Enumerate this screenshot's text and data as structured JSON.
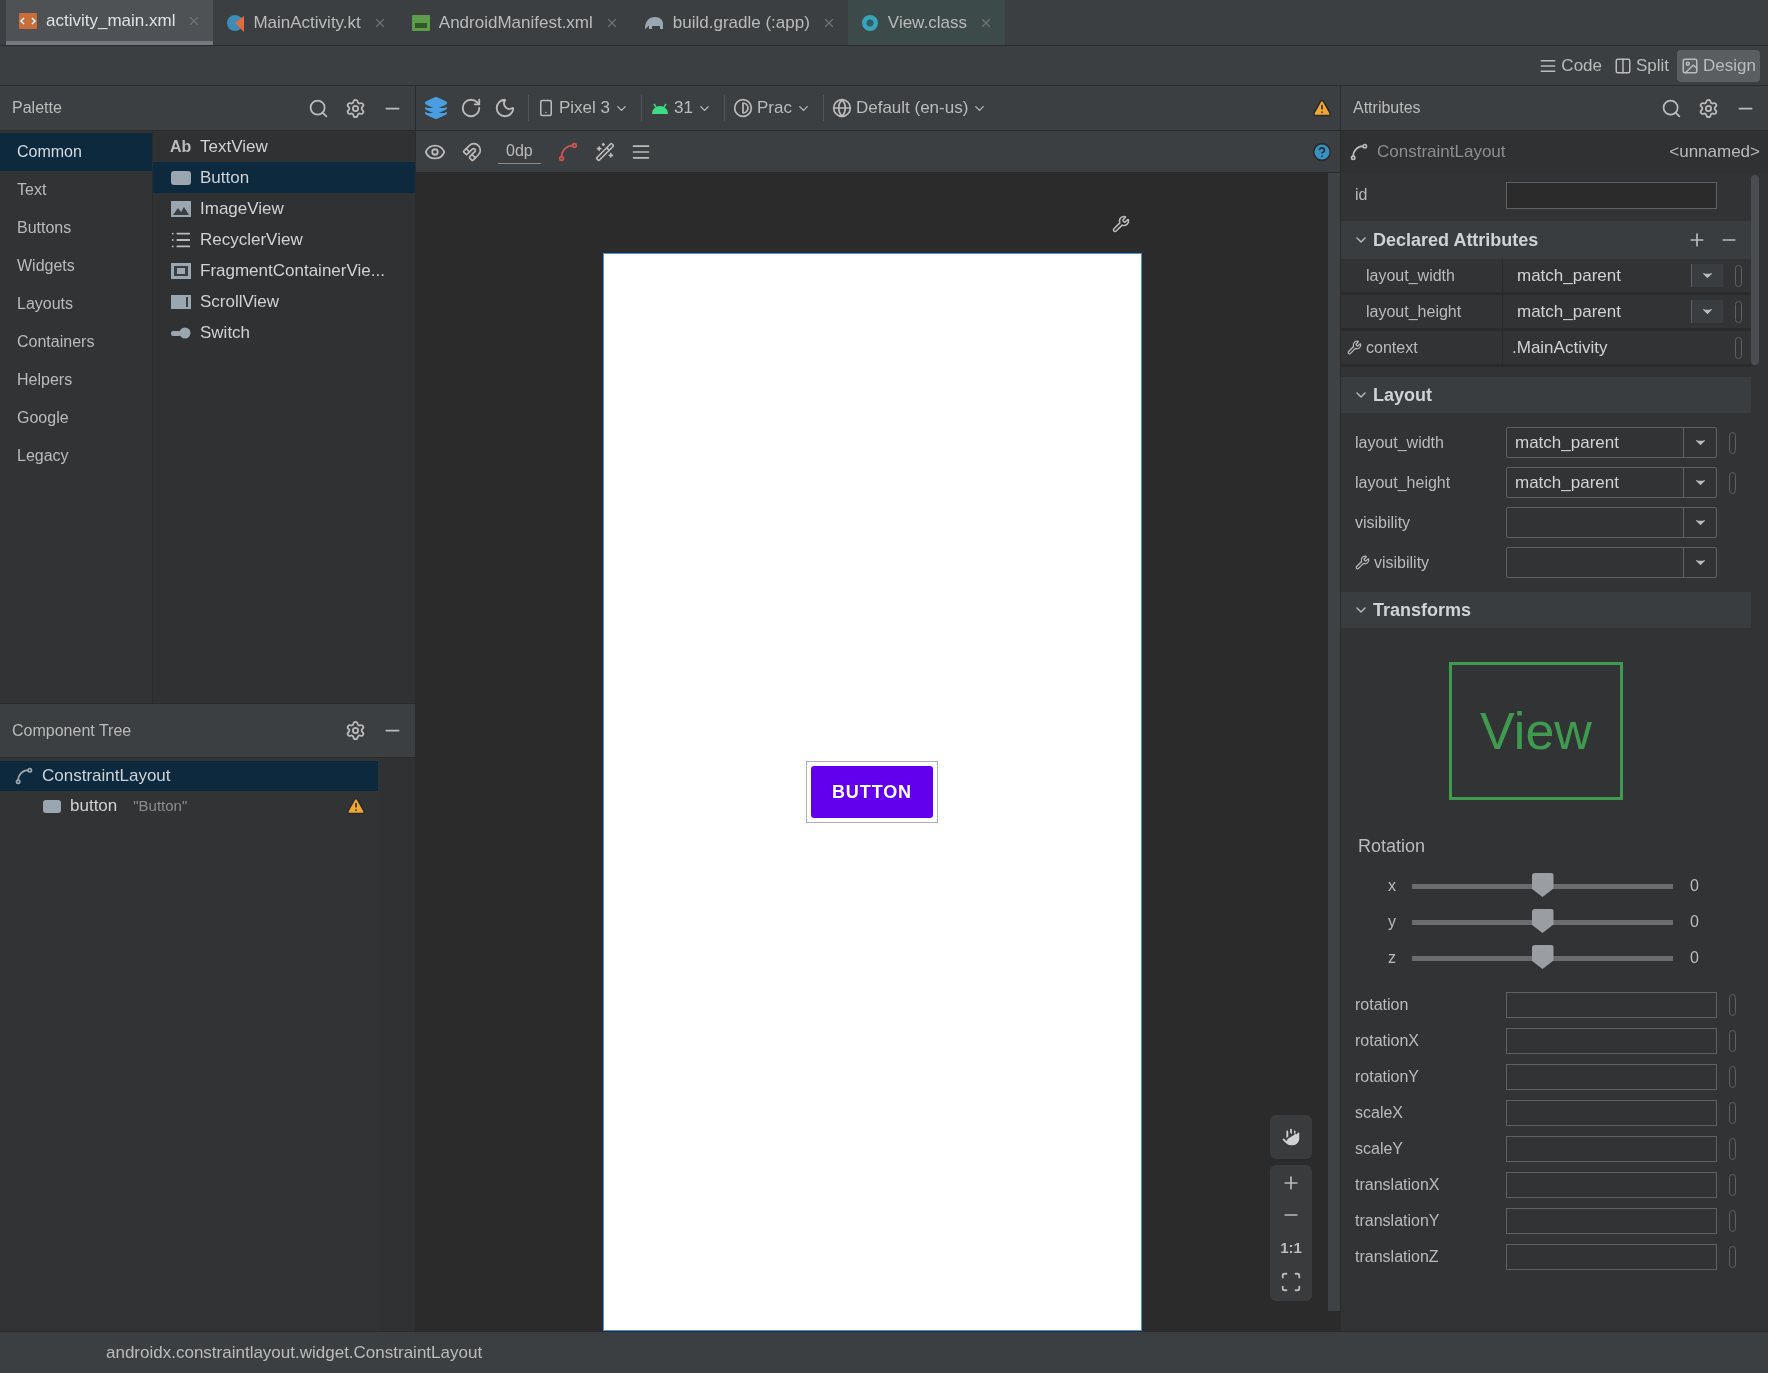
{
  "editor_tabs": [
    {
      "label": "activity_main.xml",
      "kind": "xml",
      "selected": true
    },
    {
      "label": "MainActivity.kt",
      "kind": "kotlin",
      "selected": false
    },
    {
      "label": "AndroidManifest.xml",
      "kind": "manifest",
      "selected": false
    },
    {
      "label": "build.gradle (:app)",
      "kind": "gradle",
      "selected": false
    },
    {
      "label": "View.class",
      "kind": "class",
      "selected": false
    }
  ],
  "view_modes": [
    {
      "label": "Code",
      "kind": "code",
      "selected": false
    },
    {
      "label": "Split",
      "kind": "split",
      "selected": false
    },
    {
      "label": "Design",
      "kind": "design",
      "selected": true
    }
  ],
  "palette": {
    "title": "Palette",
    "categories": [
      {
        "label": "Common",
        "selected": true
      },
      {
        "label": "Text",
        "selected": false
      },
      {
        "label": "Buttons",
        "selected": false
      },
      {
        "label": "Widgets",
        "selected": false
      },
      {
        "label": "Layouts",
        "selected": false
      },
      {
        "label": "Containers",
        "selected": false
      },
      {
        "label": "Helpers",
        "selected": false
      },
      {
        "label": "Google",
        "selected": false
      },
      {
        "label": "Legacy",
        "selected": false
      }
    ],
    "items": [
      {
        "label": "TextView",
        "kind": "text",
        "glyph": "Ab",
        "selected": false
      },
      {
        "label": "Button",
        "kind": "button",
        "selected": true
      },
      {
        "label": "ImageView",
        "kind": "image",
        "selected": false
      },
      {
        "label": "RecyclerView",
        "kind": "list",
        "selected": false
      },
      {
        "label": "FragmentContainerVie...",
        "kind": "fragment",
        "selected": false
      },
      {
        "label": "ScrollView",
        "kind": "scroll",
        "selected": false
      },
      {
        "label": "Switch",
        "kind": "switch",
        "selected": false
      }
    ]
  },
  "toolbar": {
    "dropdowns": [
      {
        "kind": "device",
        "label": "Pixel 3"
      },
      {
        "kind": "api",
        "label": "31"
      },
      {
        "kind": "theme",
        "label": "Prac"
      },
      {
        "kind": "locale",
        "label": "Default (en-us)"
      }
    ],
    "default_margin": "0dp",
    "has_issues": true
  },
  "component_tree": {
    "title": "Component Tree",
    "items": [
      {
        "label": "ConstraintLayout",
        "kind": "constraint",
        "selected": true,
        "children": [
          {
            "label": "button",
            "text": "\"Button\"",
            "kind": "button",
            "warning": true,
            "selected": false
          }
        ]
      }
    ]
  },
  "design_surface": {
    "button_label": "BUTTON",
    "zoom_actual": "1:1"
  },
  "attributes": {
    "title": "Attributes",
    "component": "ConstraintLayout",
    "name": "<unnamed>",
    "id_label": "id",
    "declared": {
      "title": "Declared Attributes",
      "expanded": true,
      "rows": [
        {
          "label": "layout_width",
          "value": "match_parent",
          "kind": "dropdown",
          "tools": false
        },
        {
          "label": "layout_height",
          "value": "match_parent",
          "kind": "dropdown",
          "tools": false
        },
        {
          "label": "context",
          "value": ".MainActivity",
          "kind": "text",
          "tools": true
        }
      ]
    },
    "layout": {
      "title": "Layout",
      "expanded": true,
      "rows": [
        {
          "label": "layout_width",
          "value": "match_parent",
          "tools": false,
          "reset": true
        },
        {
          "label": "layout_height",
          "value": "match_parent",
          "tools": false,
          "reset": true
        },
        {
          "label": "visibility",
          "tools": false,
          "reset": false
        },
        {
          "label": "visibility",
          "tools": true,
          "reset": false
        }
      ]
    },
    "transforms": {
      "title": "Transforms",
      "expanded": true,
      "preview": "View",
      "rotation_title": "Rotation",
      "sliders": [
        {
          "axis": "x",
          "level": 0.5,
          "reading": "0"
        },
        {
          "axis": "y",
          "level": 0.5,
          "reading": "0"
        },
        {
          "axis": "z",
          "level": 0.5,
          "reading": "0"
        }
      ],
      "fields": [
        {
          "label": "rotation"
        },
        {
          "label": "rotationX"
        },
        {
          "label": "rotationY"
        },
        {
          "label": "scaleX"
        },
        {
          "label": "scaleY"
        },
        {
          "label": "translationX"
        },
        {
          "label": "translationY"
        },
        {
          "label": "translationZ"
        }
      ]
    }
  },
  "status_bar": "androidx.constraintlayout.widget.ConstraintLayout"
}
